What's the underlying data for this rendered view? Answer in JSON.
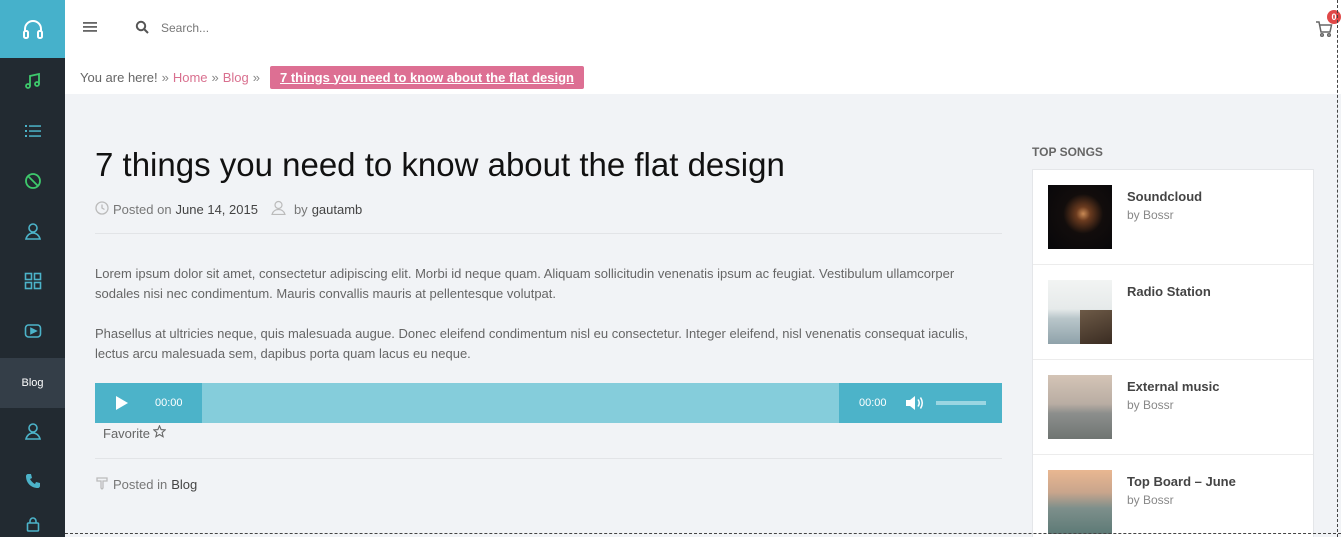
{
  "sidebar": {
    "items": [
      {
        "icon": "music-note-icon"
      },
      {
        "icon": "list-icon"
      },
      {
        "icon": "no-sign-icon"
      },
      {
        "icon": "user-icon"
      },
      {
        "icon": "grid-icon"
      },
      {
        "icon": "video-play-icon"
      },
      {
        "label": "Blog"
      },
      {
        "icon": "user-icon"
      },
      {
        "icon": "phone-icon"
      },
      {
        "icon": "lock-icon"
      }
    ]
  },
  "header": {
    "search_placeholder": "Search...",
    "cart_count": "0"
  },
  "breadcrumb": {
    "prefix": "You are here!",
    "separator": "»",
    "home": "Home",
    "blog": "Blog",
    "current": "7 things you need to know about the flat design"
  },
  "post": {
    "title": "7 things you need to know about the flat design",
    "posted_on_label": "Posted on",
    "date": "June 14, 2015",
    "by_label": "by",
    "author": "gautamb",
    "paragraphs": [
      "Lorem ipsum dolor sit amet, consectetur adipiscing elit. Morbi id neque quam. Aliquam sollicitudin venenatis ipsum ac feugiat. Vestibulum ullamcorper sodales nisi nec condimentum. Mauris convallis mauris at pellentesque volutpat.",
      "Phasellus at ultricies neque, quis malesuada augue. Donec eleifend condimentum nisl eu consectetur. Integer eleifend, nisl venenatis consequat iaculis, lectus arcu malesuada sem, dapibus porta quam lacus eu neque."
    ],
    "player": {
      "current_time": "00:00",
      "duration": "00:00"
    },
    "favorite_label": "Favorite",
    "posted_in_label": "Posted in",
    "category": "Blog"
  },
  "top_songs": {
    "heading": "TOP SONGS",
    "items": [
      {
        "title": "Soundcloud",
        "artist": "by Bossr"
      },
      {
        "title": "Radio Station",
        "artist": ""
      },
      {
        "title": "External music",
        "artist": "by Bossr"
      },
      {
        "title": "Top Board – June",
        "artist": "by Bossr"
      }
    ]
  },
  "colors": {
    "accent": "#46b1cb",
    "pink": "#dd6f93",
    "green_icon": "#3ec96c",
    "sidebar_bg": "#222a31"
  }
}
